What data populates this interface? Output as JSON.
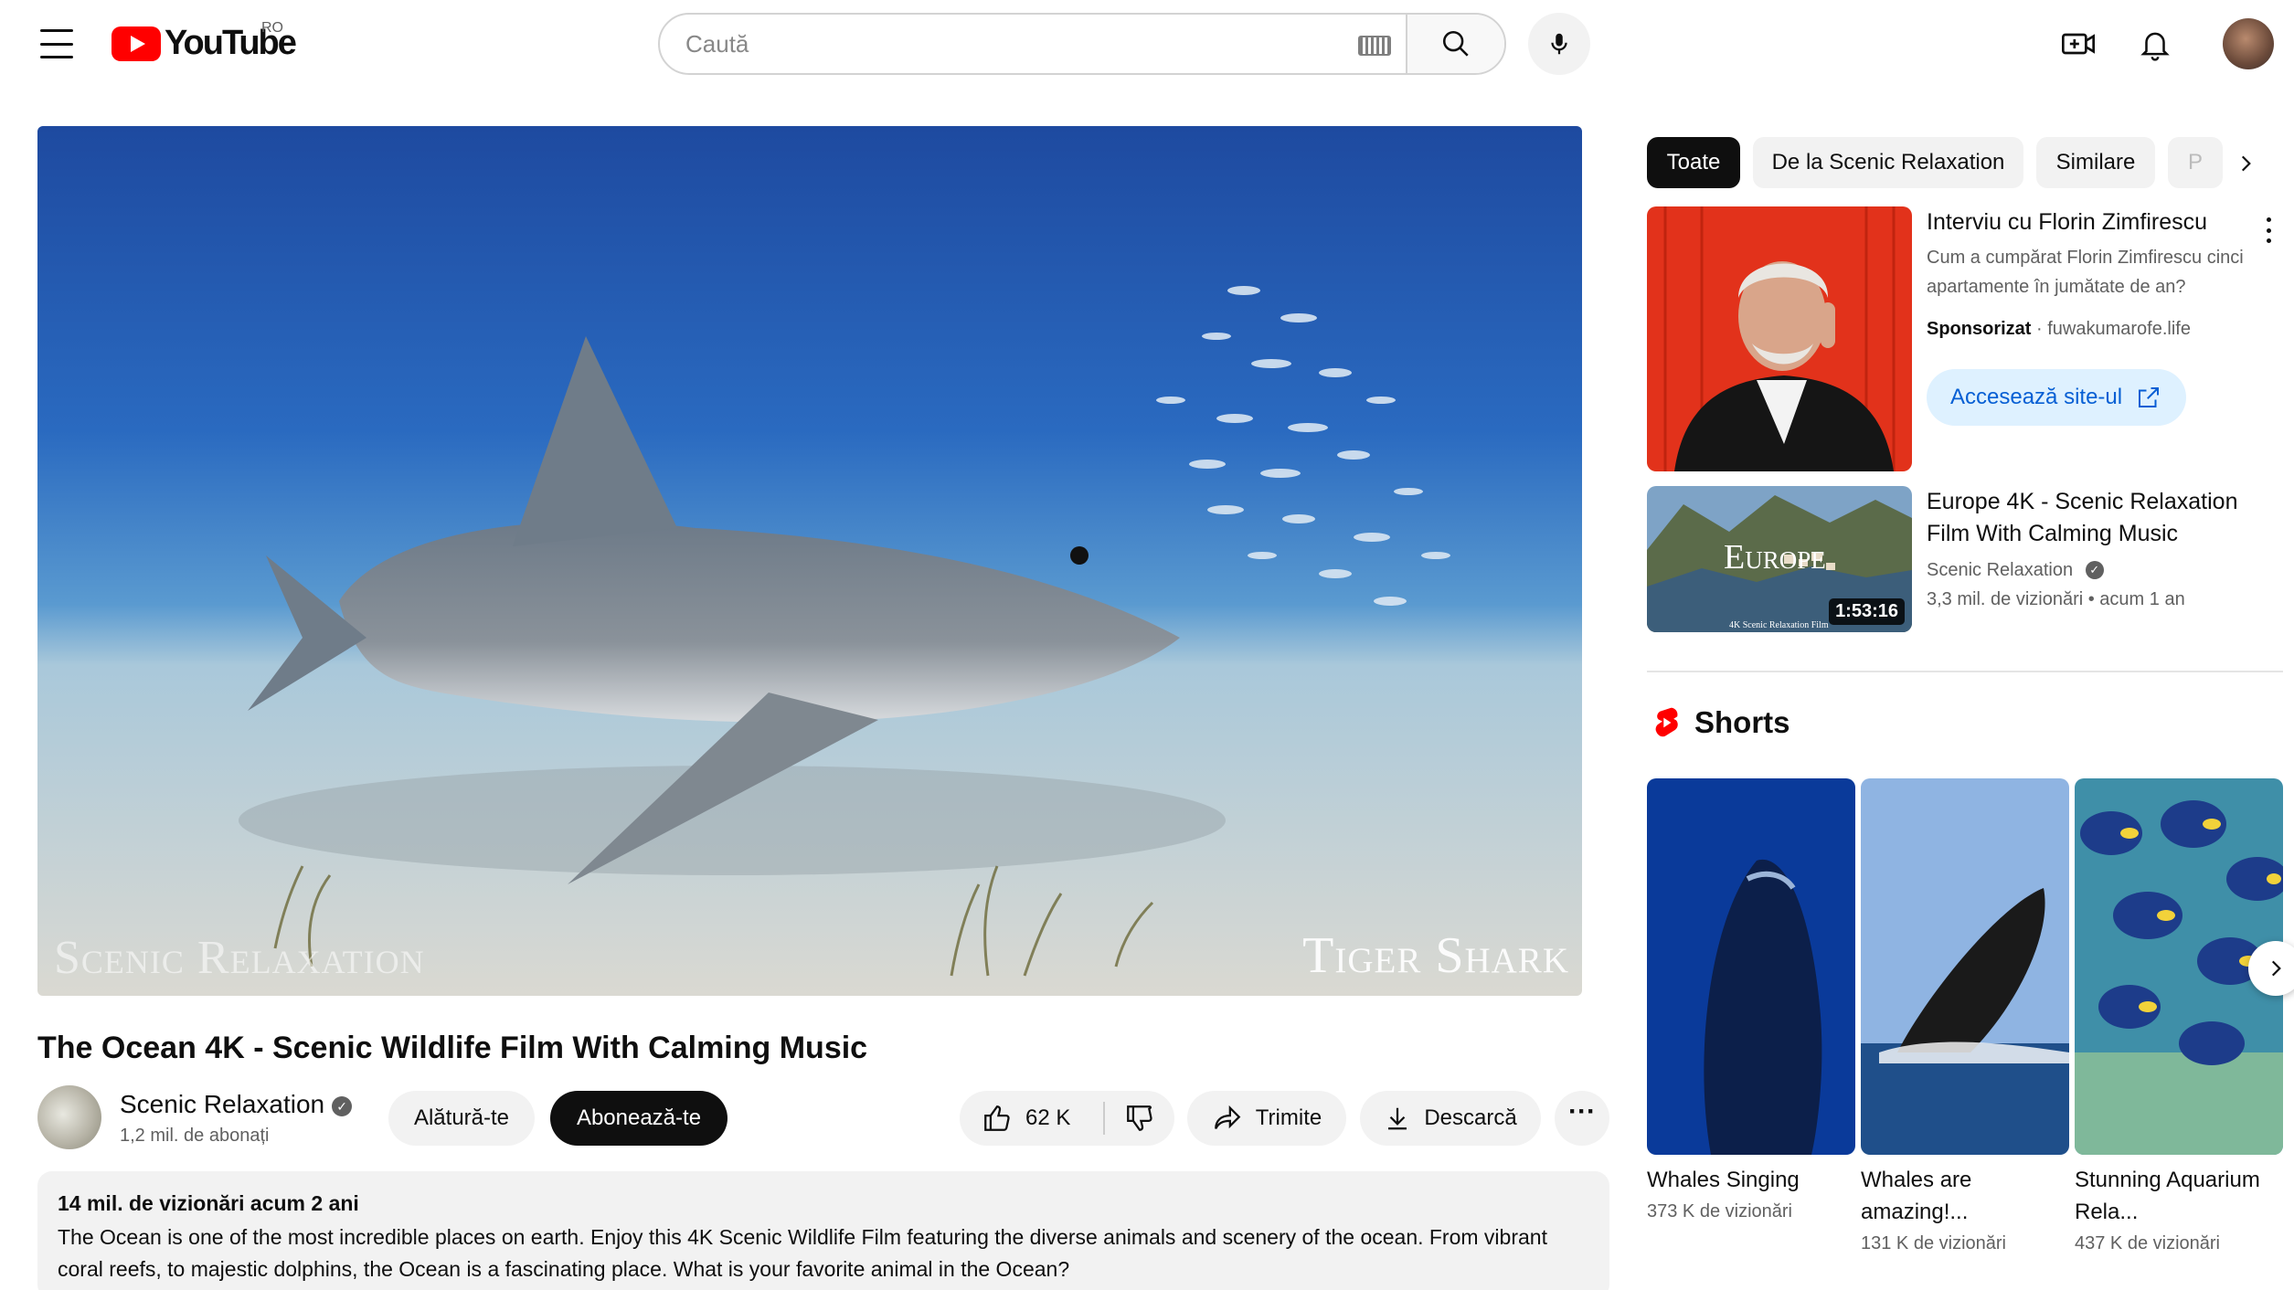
{
  "header": {
    "logo_text": "YouTube",
    "country_code": "RO",
    "search_placeholder": "Caută",
    "icons": [
      "menu-icon",
      "keyboard-icon",
      "search-icon",
      "mic-icon",
      "create-icon",
      "bell-icon"
    ]
  },
  "player": {
    "watermark_left": "Scenic Relaxation",
    "watermark_right": "Tiger Shark"
  },
  "video": {
    "title": "The Ocean 4K - Scenic Wildlife Film With Calming Music",
    "channel_name": "Scenic Relaxation",
    "subscribers": "1,2 mil. de abonați",
    "join_label": "Alătură-te",
    "subscribe_label": "Abonează-te",
    "likes": "62 K",
    "share_label": "Trimite",
    "download_label": "Descarcă",
    "description_meta": "14 mil. de vizionări  acum 2 ani",
    "description": "The Ocean is one of the most incredible places on earth. Enjoy this 4K Scenic Wildlife Film featuring the diverse animals and scenery of the ocean. From vibrant coral reefs, to majestic dolphins, the Ocean is a fascinating place. What is your favorite animal in the Ocean?"
  },
  "sidebar": {
    "chips": [
      {
        "label": "Toate",
        "active": true
      },
      {
        "label": "De la Scenic Relaxation",
        "active": false
      },
      {
        "label": "Similare",
        "active": false
      },
      {
        "label": "P",
        "active": false
      }
    ],
    "ad": {
      "title": "Interviu cu Florin Zimfirescu",
      "text": "Cum a cumpărat Florin Zimfirescu cinci apartamente în jumătate de an?",
      "sponsored": "Sponsorizat",
      "domain": "fuwakumarofe.life",
      "cta": "Accesează site-ul"
    },
    "recommended": {
      "title": "Europe 4K - Scenic Relaxation Film With Calming Music",
      "channel": "Scenic Relaxation",
      "meta": "3,3 mil. de vizionări  • acum 1 an",
      "duration": "1:53:16",
      "thumb_title": "Europe",
      "thumb_caption": "4K Scenic Relaxation Film"
    },
    "shorts_label": "Shorts",
    "shorts": [
      {
        "title": "Whales Singing",
        "views": "373 K de vizionări"
      },
      {
        "title": "Whales are amazing!...",
        "views": "131 K de vizionări"
      },
      {
        "title": "Stunning Aquarium Rela...",
        "views": "437 K de vizionări"
      }
    ]
  },
  "colors": {
    "brand_red": "#ff0000",
    "link_blue": "#065fd4",
    "chip_active": "#0f0f0f",
    "chip_bg": "#f2f2f2"
  }
}
